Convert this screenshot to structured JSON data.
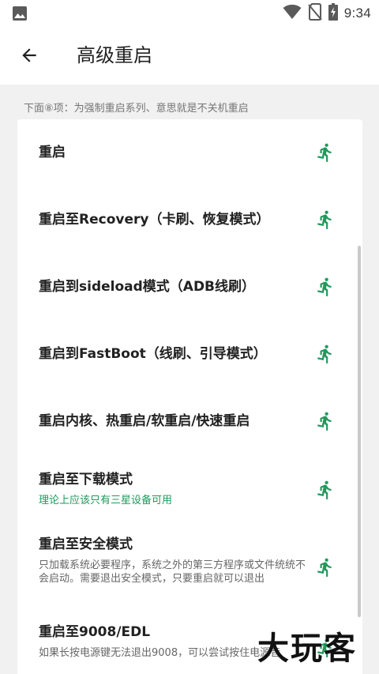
{
  "status_bar": {
    "time": "9:34",
    "icons": [
      "gallery-icon",
      "wifi-icon",
      "no-sim-icon",
      "battery-charging-icon"
    ]
  },
  "app_bar": {
    "back_icon": "arrow-left-icon",
    "title": "高级重启"
  },
  "section_header": "下面⑧项：为强制重启系列、意思就是不关机重启",
  "items": [
    {
      "label": "重启",
      "sub": ""
    },
    {
      "label": "重启至Recovery（卡刷、恢复模式）",
      "sub": ""
    },
    {
      "label": "重启到sideload模式（ADB线刷）",
      "sub": ""
    },
    {
      "label": "重启到FastBoot（线刷、引导模式）",
      "sub": ""
    },
    {
      "label": "重启内核、热重启/软重启/快速重启",
      "sub": ""
    },
    {
      "label": "重启至下载模式",
      "sub": "理论上应该只有三星设备可用"
    },
    {
      "label": "重启至安全模式",
      "sub": "只加载系统必要程序，系统之外的第三方程序或文件统统不会启动。需要退出安全模式，只要重启就可以退出"
    },
    {
      "label": "重启至9008/EDL",
      "sub": "如果长按电源键无法退出9008，可以尝试按住电源音"
    }
  ],
  "watermark": "大玩客",
  "colors": {
    "accent": "#1e9a5c",
    "background": "#f1f1f1",
    "card": "#ffffff"
  }
}
